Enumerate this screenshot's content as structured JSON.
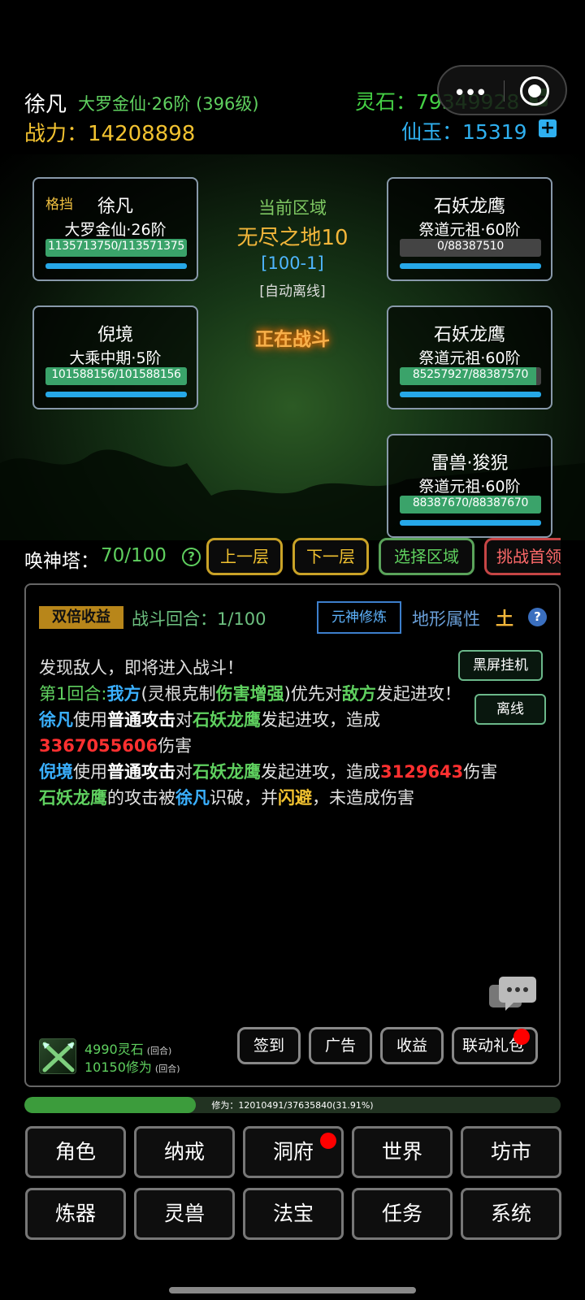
{
  "header": {
    "player_name": "徐凡",
    "realm": "大罗金仙·26阶 (396级)",
    "power_label": "战力：",
    "power_value": "14208898",
    "lingshi_label": "灵石：",
    "lingshi_value": "79349928",
    "xianyu_label": "仙玉：",
    "xianyu_value": "15319",
    "plus_symbol": "+",
    "colors": {
      "gold": "#f2c230",
      "green": "#45d045",
      "blue": "#2fb0f0"
    }
  },
  "capsule": {
    "menu_icon": "more-dots-icon",
    "close_icon": "record-icon",
    "menu_glyph": "•••"
  },
  "allies": [
    {
      "tag": "格挡",
      "name": "徐凡",
      "realm": "大罗金仙·26阶",
      "hp_text": "1135713750/113571375",
      "hp_ratio": 1.0
    },
    {
      "tag": "",
      "name": "倪境",
      "realm": "大乘中期·5阶",
      "hp_text": "101588156/101588156",
      "hp_ratio": 1.0
    }
  ],
  "enemies": [
    {
      "name": "石妖龙鹰",
      "realm": "祭道元祖·60阶",
      "hp_text": "0/88387510",
      "hp_ratio": 0.0
    },
    {
      "name": "石妖龙鹰",
      "realm": "祭道元祖·60阶",
      "hp_text": "85257927/88387570",
      "hp_ratio": 0.965
    },
    {
      "name": "雷兽·狻猊",
      "realm": "祭道元祖·60阶",
      "hp_text": "88387670/88387670",
      "hp_ratio": 1.0
    }
  ],
  "zone": {
    "label": "当前区域",
    "name": "无尽之地10",
    "code": "[100-1]",
    "mode": "[自动离线]",
    "status": "正在战斗"
  },
  "tower": {
    "label": "唤神塔：",
    "value": "70/100",
    "help_glyph": "?",
    "buttons": [
      {
        "label": "上一层",
        "color": "#c9a227"
      },
      {
        "label": "下一层",
        "color": "#c9a227"
      },
      {
        "label": "选择区域",
        "color": "#5aa35a"
      },
      {
        "label": "挑战首领",
        "color": "#c64545"
      }
    ]
  },
  "battle": {
    "double_label": "双倍收益",
    "round_label": "战斗回合：",
    "round_value": "1/100",
    "yuanshen_button": "元神修炼",
    "terrain_label": "地形属性",
    "terrain_value": "土",
    "help_glyph": "?",
    "side_buttons": [
      "黑屏挂机",
      "离线"
    ],
    "log": {
      "l1": "发现敌人，即将进入战斗！",
      "l2": [
        "第1回合:",
        "我方",
        "(灵根克制",
        "伤害增强",
        ")优先对",
        "敌方",
        "发起进攻！"
      ],
      "l3": [
        "徐凡",
        "使用",
        "普通攻击",
        "对",
        "石妖龙鹰",
        "发起进攻，造成"
      ],
      "l4": [
        "3367055606",
        "伤害"
      ],
      "l5": [
        "倪境",
        "使用",
        "普通攻击",
        "对",
        "石妖龙鹰",
        "发起进攻，造成",
        "3129643",
        "伤害"
      ],
      "l6": [
        "石妖龙鹰",
        "的攻击被",
        "徐凡",
        "识破，并",
        "闪避",
        "，未造成伤害"
      ]
    },
    "chat_icon": "chat-bubble-icon",
    "earn_icon": "crossed-swords-icon",
    "earn_lingshi": "4990灵石",
    "earn_xiuwei": "10150修为",
    "per_round": "(回合)",
    "bottom_buttons": [
      "签到",
      "广告",
      "收益",
      "联动礼包"
    ]
  },
  "progress": {
    "label": "修为：",
    "text": "12010491/37635840(31.91%)",
    "ratio": 0.3191
  },
  "nav": {
    "row1": [
      "角色",
      "纳戒",
      "洞府",
      "世界",
      "坊市"
    ],
    "row2": [
      "炼器",
      "灵兽",
      "法宝",
      "任务",
      "系统"
    ]
  }
}
